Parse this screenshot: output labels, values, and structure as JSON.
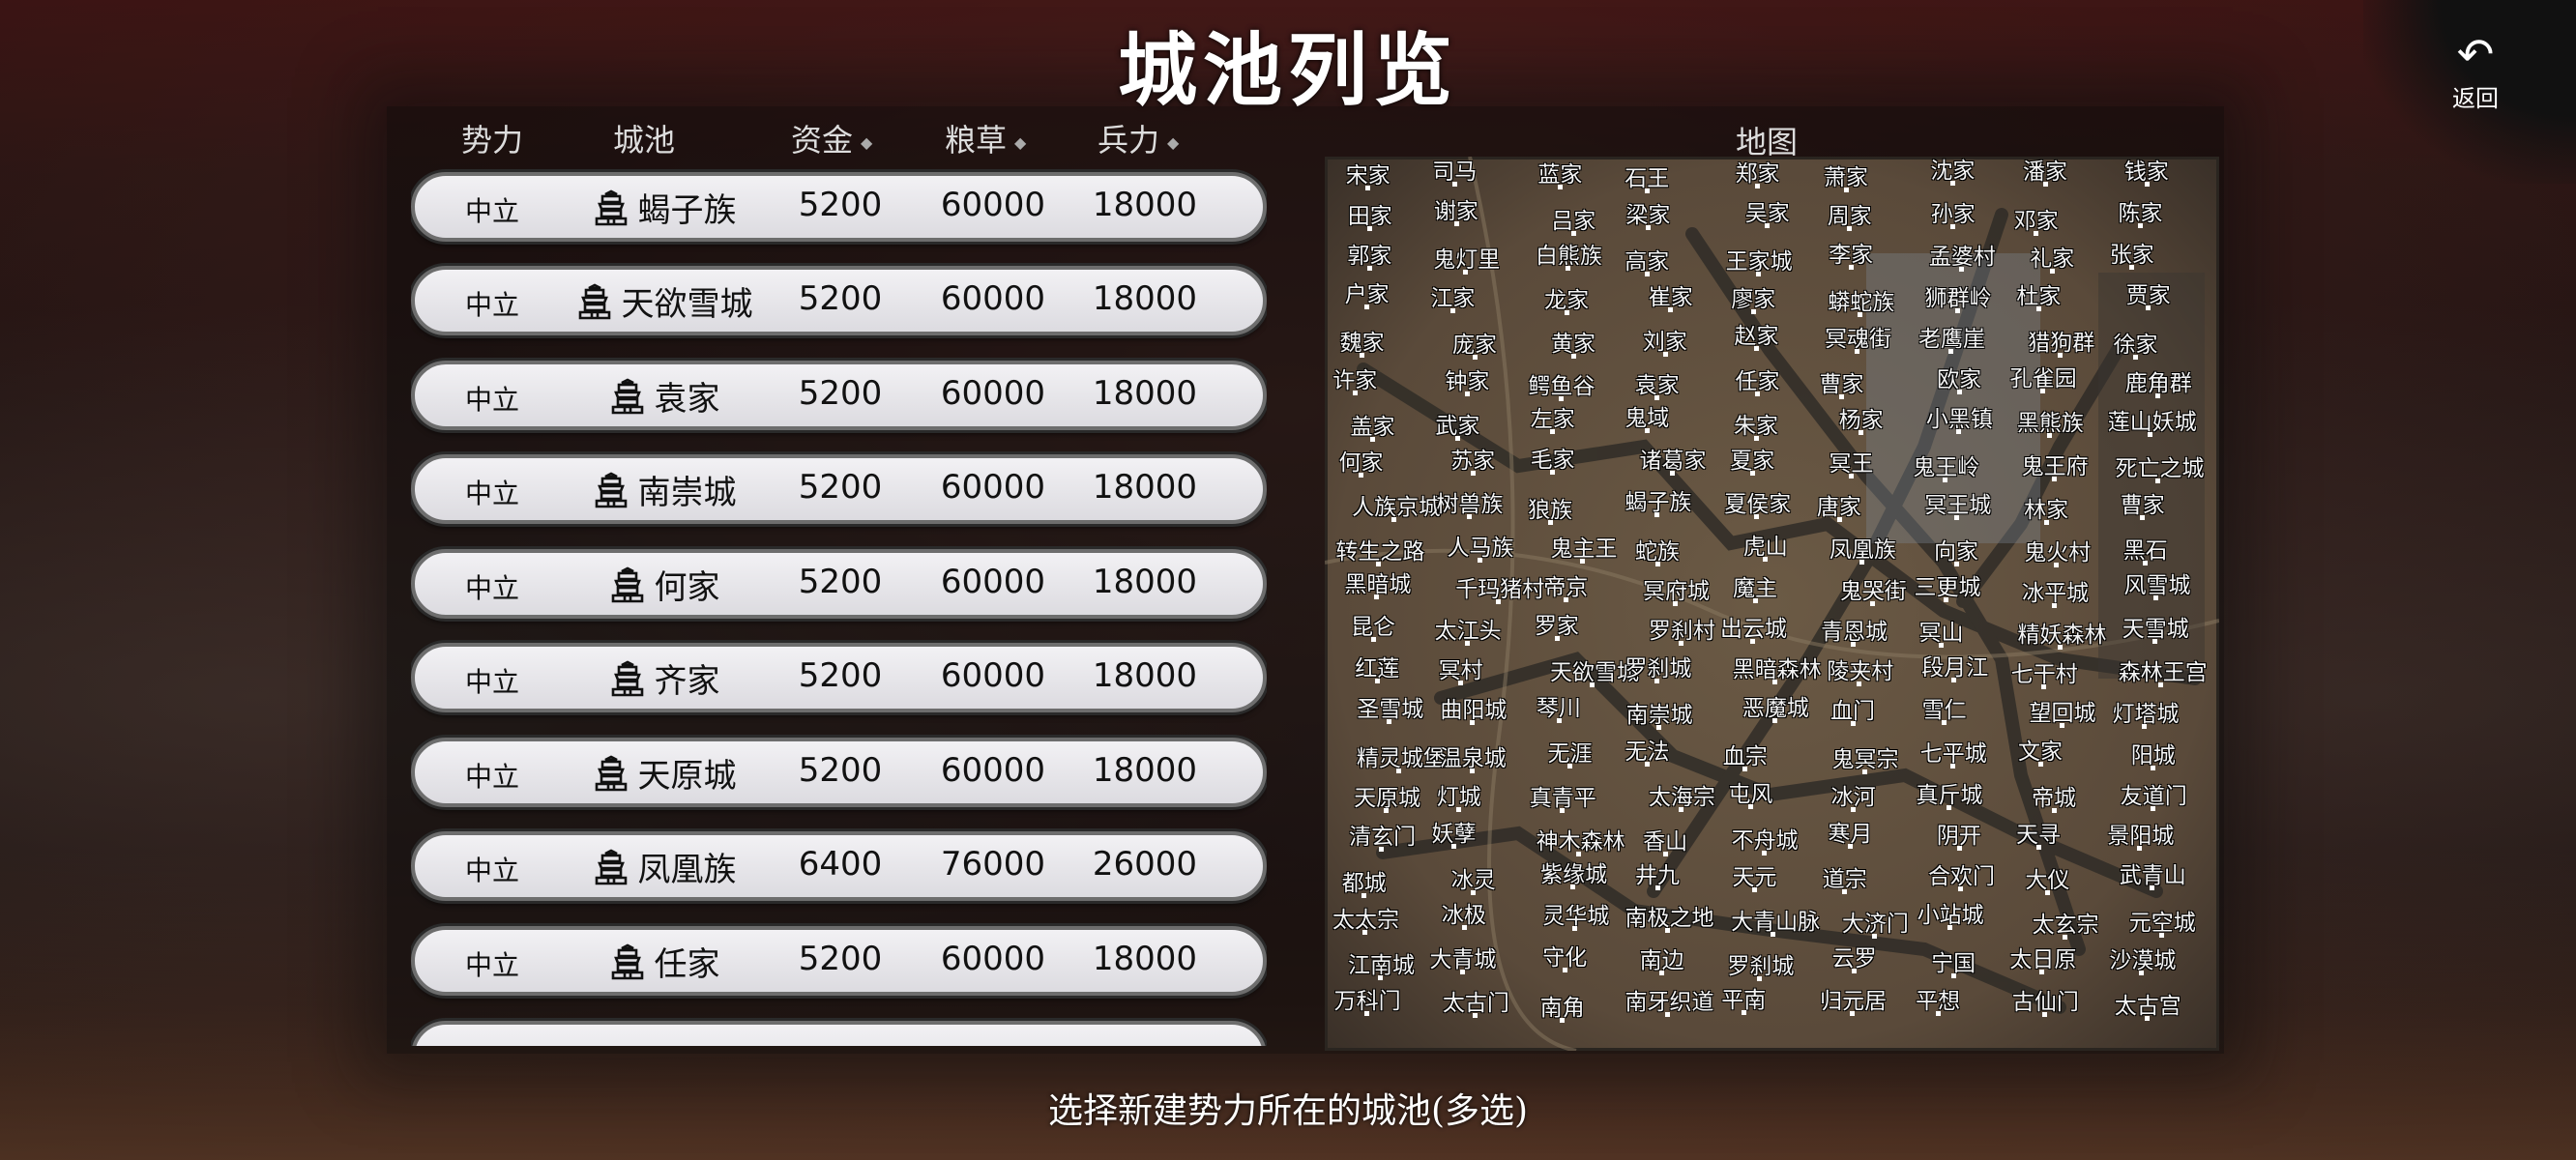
{
  "title": "城池列览",
  "back": {
    "label": "返回",
    "icon": "back-arrow-icon"
  },
  "table": {
    "headers": {
      "faction": "势力",
      "city": "城池",
      "gold": "资金",
      "food": "粮草",
      "troops": "兵力"
    },
    "sort_icon": "◆",
    "rows": [
      {
        "faction": "中立",
        "city": "蝎子族",
        "gold": "5200",
        "food": "60000",
        "troops": "18000"
      },
      {
        "faction": "中立",
        "city": "天欲雪城",
        "gold": "5200",
        "food": "60000",
        "troops": "18000"
      },
      {
        "faction": "中立",
        "city": "袁家",
        "gold": "5200",
        "food": "60000",
        "troops": "18000"
      },
      {
        "faction": "中立",
        "city": "南崇城",
        "gold": "5200",
        "food": "60000",
        "troops": "18000"
      },
      {
        "faction": "中立",
        "city": "何家",
        "gold": "5200",
        "food": "60000",
        "troops": "18000"
      },
      {
        "faction": "中立",
        "city": "齐家",
        "gold": "5200",
        "food": "60000",
        "troops": "18000"
      },
      {
        "faction": "中立",
        "city": "天原城",
        "gold": "5200",
        "food": "60000",
        "troops": "18000"
      },
      {
        "faction": "中立",
        "city": "凤凰族",
        "gold": "6400",
        "food": "76000",
        "troops": "26000"
      },
      {
        "faction": "中立",
        "city": "任家",
        "gold": "5200",
        "food": "60000",
        "troops": "18000"
      }
    ]
  },
  "map": {
    "title": "地图",
    "labels": [
      "宋家",
      "司马",
      "蓝家",
      "石王",
      "郑家",
      "萧家",
      "沈家",
      "潘家",
      "钱家",
      "田家",
      "谢家",
      "吕家",
      "梁家",
      "吴家",
      "周家",
      "孙家",
      "邓家",
      "陈家",
      "郭家",
      "鬼灯里",
      "白熊族",
      "高家",
      "王家城",
      "李家",
      "孟婆村",
      "礼家",
      "张家",
      "户家",
      "江家",
      "龙家",
      "崔家",
      "廖家",
      "蟒蛇族",
      "狮群岭",
      "杜家",
      "贾家",
      "魏家",
      "庞家",
      "黄家",
      "刘家",
      "赵家",
      "冥魂街",
      "老鹰崖",
      "猎狗群",
      "徐家",
      "许家",
      "钟家",
      "鳄鱼谷",
      "袁家",
      "任家",
      "曹家",
      "欧家",
      "孔雀园",
      "鹿角群",
      "盖家",
      "武家",
      "左家",
      "鬼域",
      "朱家",
      "杨家",
      "小黑镇",
      "黑熊族",
      "莲山妖城",
      "何家",
      "苏家",
      "毛家",
      "诸葛家",
      "夏家",
      "冥王",
      "鬼王岭",
      "鬼王府",
      "死亡之城",
      "人族京城",
      "树兽族",
      "狼族",
      "蝎子族",
      "夏侯家",
      "唐家",
      "冥王城",
      "林家",
      "曹家",
      "转生之路",
      "人马族",
      "鬼主王",
      "蛇族",
      "虎山",
      "凤凰族",
      "向家",
      "鬼火村",
      "黑石",
      "黑暗城",
      "千玛猪村",
      "帝京",
      "冥府城",
      "魔主",
      "鬼哭街",
      "三更城",
      "冰平城",
      "风雪城",
      "昆仑",
      "太江头",
      "罗家",
      "罗刹村",
      "出云城",
      "青恩城",
      "冥山",
      "精妖森林",
      "天雪城",
      "红莲",
      "冥村",
      "天欲雪城",
      "罗刹城",
      "黑暗森林",
      "陵夹村",
      "段月江",
      "七干村",
      "森林王宫",
      "圣雪城",
      "曲阳城",
      "琴川",
      "南崇城",
      "恶魔城",
      "血门",
      "雪仁",
      "望回城",
      "灯塔城",
      "精灵城堡",
      "温泉城",
      "无涯",
      "无法",
      "血宗",
      "鬼冥宗",
      "七平城",
      "文家",
      "阳城",
      "天原城",
      "灯城",
      "真青平",
      "太海宗",
      "屯风",
      "冰河",
      "真斤城",
      "帝城",
      "友道门",
      "清玄门",
      "妖孽",
      "神木森林",
      "香山",
      "不舟城",
      "寒月",
      "阴开",
      "天寻",
      "景阳城",
      "都城",
      "冰灵",
      "紫缘城",
      "井九",
      "天元",
      "道宗",
      "合欢门",
      "大仪",
      "武青山",
      "太太宗",
      "冰极",
      "灵华城",
      "南极之地",
      "大青山脉",
      "大济门",
      "小站城",
      "太玄宗",
      "元空城",
      "江南城",
      "大青城",
      "守化",
      "南边",
      "罗刹城",
      "云罗",
      "宁国",
      "太日原",
      "沙漠城",
      "万科门",
      "太古门",
      "南角",
      "南牙织道",
      "平南",
      "归元居",
      "平想",
      "古仙门",
      "太古宫"
    ]
  },
  "footer": "选择新建势力所在的城池(多选)"
}
